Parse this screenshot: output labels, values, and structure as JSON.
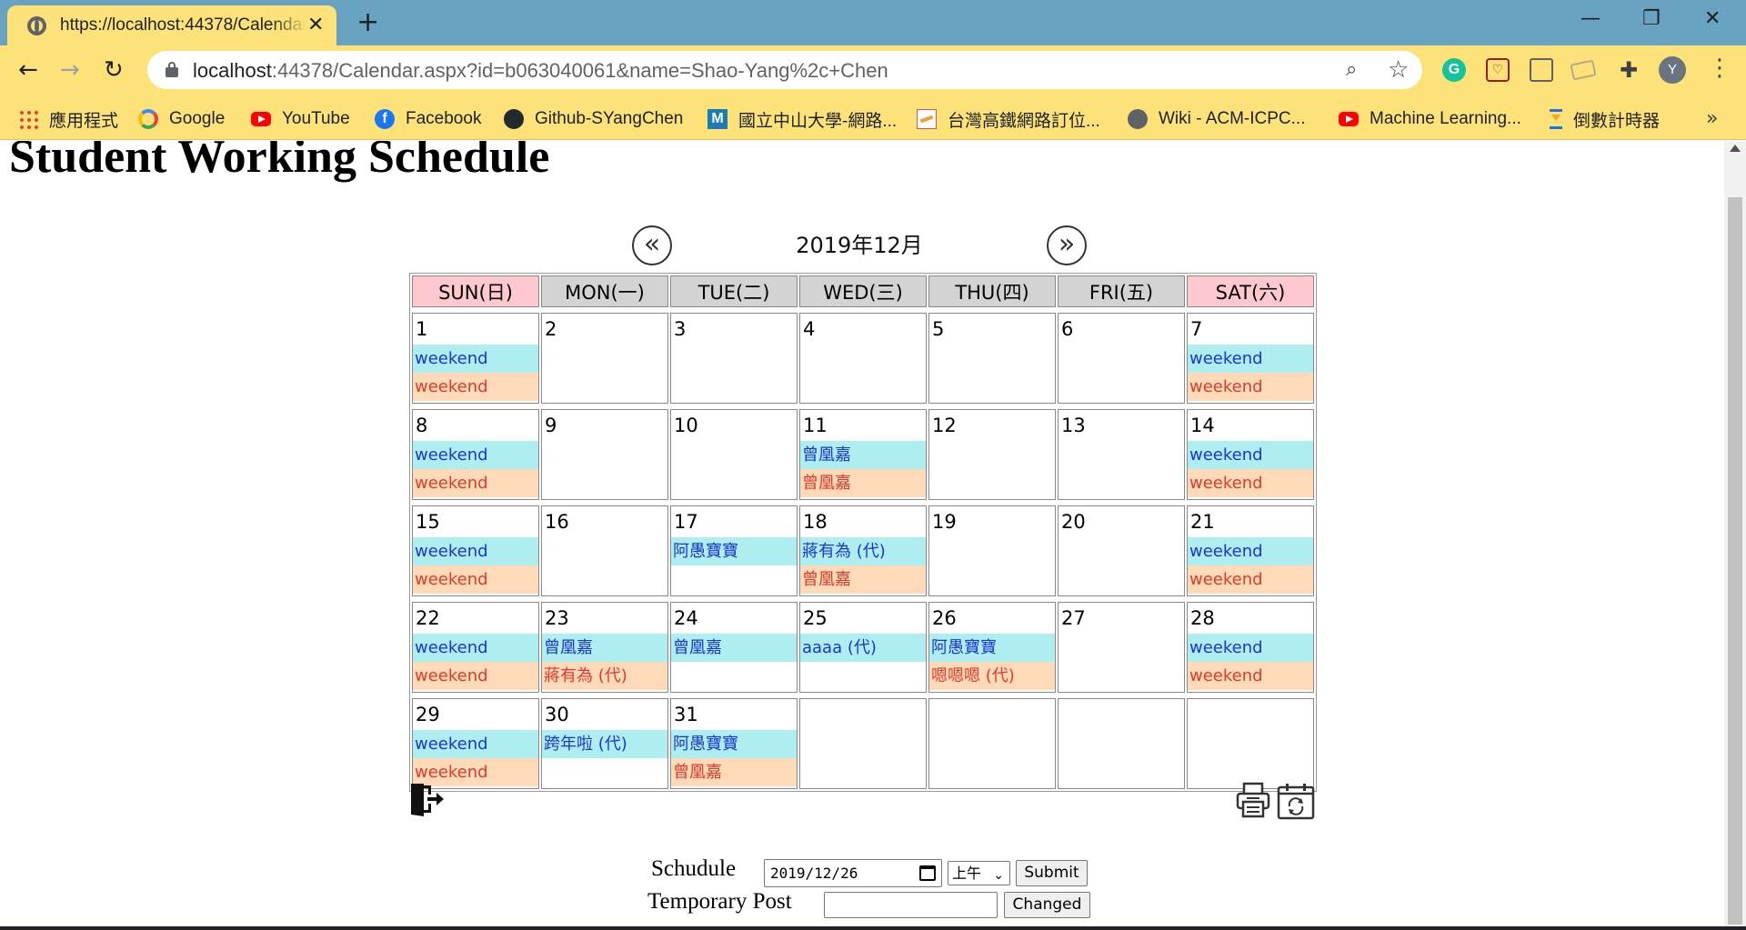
{
  "browser": {
    "tab_title": "https://localhost:44378/Calendar.aspx?id=b063040061&name=Shao-Yang%2c+Chen",
    "url_host": "localhost",
    "url_rest": ":44378/Calendar.aspx?id=b063040061&name=Shao-Yang%2c+Chen",
    "avatar_letter": "Y",
    "bookmarks": [
      {
        "label": "應用程式",
        "icon": "apps-icon"
      },
      {
        "label": "Google",
        "icon": "google-icon"
      },
      {
        "label": "YouTube",
        "icon": "youtube-icon"
      },
      {
        "label": "Facebook",
        "icon": "facebook-icon"
      },
      {
        "label": "Github-SYangChen",
        "icon": "github-icon"
      },
      {
        "label": "國立中山大學-網路...",
        "icon": "m-icon"
      },
      {
        "label": "台灣高鐵網路訂位...",
        "icon": "thsr-icon"
      },
      {
        "label": "Wiki - ACM-ICPC...",
        "icon": "globe-icon"
      },
      {
        "label": "Machine Learning...",
        "icon": "youtube-icon"
      },
      {
        "label": "倒數計時器",
        "icon": "hourglass-icon"
      }
    ]
  },
  "page": {
    "heading": "Student Working Schedule",
    "month_title": "2019年12月",
    "prev_glyph": "«",
    "next_glyph": "»"
  },
  "calendar": {
    "headers": [
      "SUN(日)",
      "MON(一)",
      "TUE(二)",
      "WED(三)",
      "THU(四)",
      "FRI(五)",
      "SAT(六)"
    ],
    "weeks": [
      [
        {
          "day": "1",
          "am": "weekend",
          "pm": "weekend"
        },
        {
          "day": "2",
          "am": "",
          "pm": ""
        },
        {
          "day": "3",
          "am": "",
          "pm": ""
        },
        {
          "day": "4",
          "am": "",
          "pm": ""
        },
        {
          "day": "5",
          "am": "",
          "pm": ""
        },
        {
          "day": "6",
          "am": "",
          "pm": ""
        },
        {
          "day": "7",
          "am": "weekend",
          "pm": "weekend"
        }
      ],
      [
        {
          "day": "8",
          "am": "weekend",
          "pm": "weekend"
        },
        {
          "day": "9",
          "am": "",
          "pm": ""
        },
        {
          "day": "10",
          "am": "",
          "pm": ""
        },
        {
          "day": "11",
          "am": "曾凰嘉",
          "pm": "曾凰嘉"
        },
        {
          "day": "12",
          "am": "",
          "pm": ""
        },
        {
          "day": "13",
          "am": "",
          "pm": ""
        },
        {
          "day": "14",
          "am": "weekend",
          "pm": "weekend"
        }
      ],
      [
        {
          "day": "15",
          "am": "weekend",
          "pm": "weekend"
        },
        {
          "day": "16",
          "am": "",
          "pm": ""
        },
        {
          "day": "17",
          "am": "阿愚寶寶",
          "pm": ""
        },
        {
          "day": "18",
          "am": "蔣有為 (代)",
          "pm": "曾凰嘉"
        },
        {
          "day": "19",
          "am": "",
          "pm": ""
        },
        {
          "day": "20",
          "am": "",
          "pm": ""
        },
        {
          "day": "21",
          "am": "weekend",
          "pm": "weekend"
        }
      ],
      [
        {
          "day": "22",
          "am": "weekend",
          "pm": "weekend"
        },
        {
          "day": "23",
          "am": "曾凰嘉",
          "pm": "蔣有為 (代)"
        },
        {
          "day": "24",
          "am": "曾凰嘉",
          "pm": ""
        },
        {
          "day": "25",
          "am": "aaaa (代)",
          "pm": ""
        },
        {
          "day": "26",
          "am": "阿愚寶寶",
          "pm": "嗯嗯嗯 (代)"
        },
        {
          "day": "27",
          "am": "",
          "pm": ""
        },
        {
          "day": "28",
          "am": "weekend",
          "pm": "weekend"
        }
      ],
      [
        {
          "day": "29",
          "am": "weekend",
          "pm": "weekend"
        },
        {
          "day": "30",
          "am": "跨年啦 (代)",
          "pm": ""
        },
        {
          "day": "31",
          "am": "阿愚寶寶",
          "pm": "曾凰嘉"
        },
        {
          "day": "",
          "am": "",
          "pm": ""
        },
        {
          "day": "",
          "am": "",
          "pm": ""
        },
        {
          "day": "",
          "am": "",
          "pm": ""
        },
        {
          "day": "",
          "am": "",
          "pm": ""
        }
      ]
    ]
  },
  "form": {
    "schedule_label": "Schudule",
    "date_value": "2019/12/26",
    "ampm_value": "上午",
    "submit_label": "Submit",
    "temp_label": "Temporary Post",
    "temp_value": "",
    "changed_label": "Changed"
  },
  "colors": {
    "am_bg": "#aeeef0",
    "pm_bg": "#ffdab8",
    "am_text": "#1a35d6",
    "pm_text": "#e23a2a",
    "weekend_header": "#ffc8ce",
    "weekday_header": "#d3d3d3",
    "chrome_yellow": "#fde27a",
    "tabbar_blue": "#6aa3c2"
  }
}
